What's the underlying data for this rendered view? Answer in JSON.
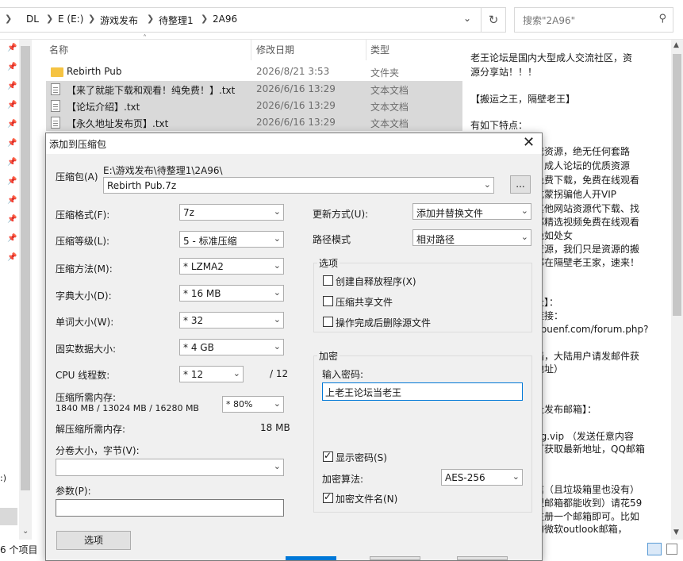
{
  "breadcrumb": {
    "items": [
      "DL",
      "E (E:)",
      "游戏发布",
      "待整理1",
      "2A96"
    ]
  },
  "search": {
    "placeholder": "搜索\"2A96\""
  },
  "columns": {
    "name": "名称",
    "date": "修改日期",
    "type": "类型"
  },
  "files": [
    {
      "name": "Rebirth Pub",
      "date": "2026/8/21 3:53",
      "type": "文件夹",
      "icon": "folder-icon",
      "selected": false
    },
    {
      "name": "【来了就能下载和观看！纯免费！】.txt",
      "date": "2026/6/16 13:29",
      "type": "文本文档",
      "icon": "text-file-icon",
      "selected": true
    },
    {
      "name": "【论坛介绍】.txt",
      "date": "2026/6/16 13:29",
      "type": "文本文档",
      "icon": "text-file-icon",
      "selected": true
    },
    {
      "name": "【永久地址发布页】.txt",
      "date": "2026/6/16 13:29",
      "type": "文本文档",
      "icon": "text-file-icon",
      "selected": true
    }
  ],
  "status": {
    "item_count": "6 个项目",
    "left_fragment": ":)"
  },
  "preview": {
    "lines": [
      "老王论坛是国内大型成人交流社区，资",
      "源分享站！！！",
      "【搬运之王，隔壁老王】",
      "有如下特点：",
      "载资源，绝无任何套路",
      "，成人论坛的优质资源",
      "免费下载，免费在线观看",
      "坑蒙拐骗他人开VIP",
      "其他网站资源代下载、找",
      "都精选视频免费在线观看",
      "绝如处女",
      "资源，我们只是资源的搬",
      "都在隔壁老王家，速来！",
      "址】：",
      "链接：",
      "gpuenf.com/forum.php?",
      "墙，大陆用户请发邮件获",
      "地址）",
      "址发布邮箱】：",
      "ng.vip （发送任意内容",
      "可获取最新地址，QQ邮箱",
      "信（且垃圾箱里也没有）",
      "型邮箱都能收到）请花59",
      "注册一个邮箱即可。比如",
      "的微软outlook邮箱，"
    ]
  },
  "dialog": {
    "title": "添加到压缩包",
    "archive_label": "压缩包(A)",
    "archive_path": "E:\\游戏发布\\待整理1\\2A96\\",
    "archive_name": "Rebirth Pub.7z",
    "browse_label": "...",
    "format_label": "压缩格式(F):",
    "format_value": "7z",
    "level_label": "压缩等级(L):",
    "level_value": "5 - 标准压缩",
    "method_label": "压缩方法(M):",
    "method_value": "* LZMA2",
    "dict_label": "字典大小(D):",
    "dict_value": "* 16 MB",
    "word_label": "单词大小(W):",
    "word_value": "* 32",
    "solid_label": "固实数据大小:",
    "solid_value": "* 4 GB",
    "cpu_label": "CPU 线程数:",
    "cpu_value": "* 12",
    "cpu_max": "/ 12",
    "mem_label": "压缩所需内存:",
    "mem_value": "1840 MB / 13024 MB / 16280 MB",
    "mem_pct": "* 80%",
    "decomp_label": "解压缩所需内存:",
    "decomp_value": "18 MB",
    "split_label": "分卷大小，字节(V):",
    "params_label": "参数(P):",
    "options_button": "选项",
    "update_label": "更新方式(U):",
    "update_value": "添加并替换文件",
    "path_label": "路径模式",
    "path_value": "相对路径",
    "options_group": "选项",
    "opt_sfx": "创建自释放程序(X)",
    "opt_shared": "压缩共享文件",
    "opt_delete": "操作完成后删除源文件",
    "encrypt_group": "加密",
    "password_label": "输入密码:",
    "password_value": "上老王论坛当老王",
    "show_password": "显示密码(S)",
    "algo_label": "加密算法:",
    "algo_value": "AES-256",
    "encrypt_names": "加密文件名(N)"
  }
}
